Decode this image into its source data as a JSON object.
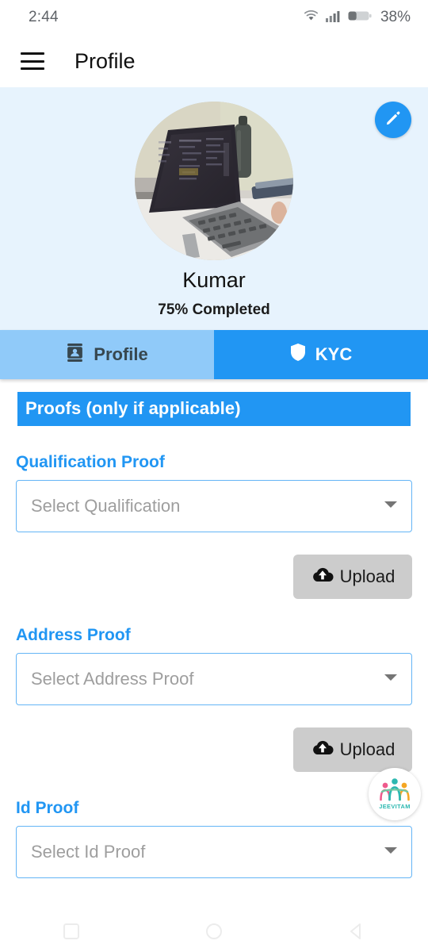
{
  "status_bar": {
    "time": "2:44",
    "battery_percent": "38%",
    "battery_level": 38,
    "icons": [
      "wifi-icon",
      "cellular-signal-icon",
      "battery-icon"
    ]
  },
  "app_bar": {
    "menu_icon": "hamburger-menu-icon",
    "title": "Profile"
  },
  "profile_header": {
    "background_color": "#e7f3fd",
    "edit_button_icon": "pencil-edit-icon",
    "edit_button_color": "#2196f3",
    "avatar_alt": "laptop-on-desk-photo",
    "name": "Kumar",
    "progress_percent": "75%",
    "progress_label": "Completed"
  },
  "tabs": [
    {
      "id": "profile",
      "label": "Profile",
      "icon": "contact-card-icon",
      "active": false,
      "bg": "#90caf9",
      "fg": "#37474f"
    },
    {
      "id": "kyc",
      "label": "KYC",
      "icon": "shield-icon",
      "active": true,
      "bg": "#2196f3",
      "fg": "#ffffff"
    }
  ],
  "section": {
    "banner_title": "Proofs (only if applicable)",
    "banner_color": "#2196f3"
  },
  "fields": [
    {
      "label": "Qualification Proof",
      "placeholder": "Select Qualification",
      "value": "",
      "caret_icon": "chevron-down-icon",
      "upload_label": "Upload",
      "upload_icon": "cloud-upload-icon"
    },
    {
      "label": "Address Proof",
      "placeholder": "Select Address Proof",
      "value": "",
      "caret_icon": "chevron-down-icon",
      "upload_label": "Upload",
      "upload_icon": "cloud-upload-icon"
    },
    {
      "label": "Id Proof",
      "placeholder": "Select Id Proof",
      "value": "",
      "caret_icon": "chevron-down-icon"
    }
  ],
  "floating_logo": {
    "brand": "JEEVITAM",
    "icon": "jeevitam-people-logo"
  },
  "nav_bar": {
    "buttons": [
      {
        "name": "recents-button",
        "icon": "square-icon"
      },
      {
        "name": "home-button",
        "icon": "circle-icon"
      },
      {
        "name": "back-button",
        "icon": "triangle-back-icon"
      }
    ]
  },
  "colors": {
    "accent": "#2196f3",
    "header_bg": "#e7f3fd",
    "tab_inactive": "#90caf9",
    "field_border": "#64b5f6",
    "upload_bg": "#cccccc",
    "placeholder_text": "#9e9e9e"
  }
}
